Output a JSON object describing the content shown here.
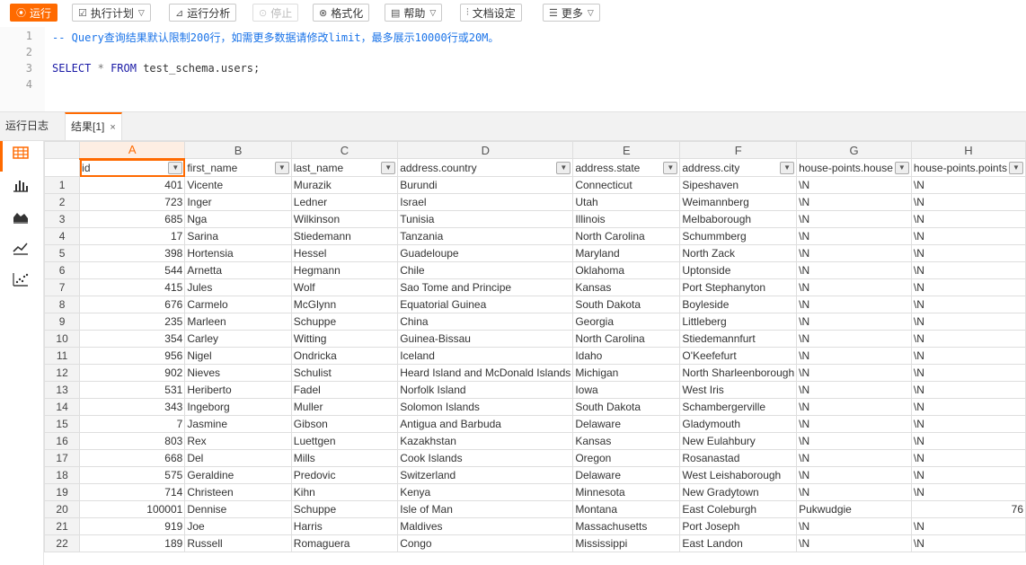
{
  "toolbar": {
    "run": "运行",
    "plan": "执行计划",
    "analyze": "运行分析",
    "stop": "停止",
    "format": "格式化",
    "help": "帮助",
    "doc_settings": "文档设定",
    "more": "更多"
  },
  "editor": {
    "line_numbers": [
      "1",
      "2",
      "3",
      "4"
    ],
    "comment": "-- Query查询结果默认限制200行，如需更多数据请修改limit，最多展示10000行或20M。",
    "sql_select": "SELECT",
    "sql_star": "*",
    "sql_from": "FROM",
    "sql_table": "test_schema.users;"
  },
  "tabs": {
    "log": "运行日志",
    "result": "结果[1]",
    "close": "×"
  },
  "grid": {
    "col_letters": [
      "A",
      "B",
      "C",
      "D",
      "E",
      "F",
      "G",
      "H"
    ],
    "fields": [
      "id",
      "first_name",
      "last_name",
      "address.country",
      "address.state",
      "address.city",
      "house-points.house",
      "house-points.points"
    ],
    "rows": [
      [
        "1",
        "401",
        "Vicente",
        "Murazik",
        "Burundi",
        "Connecticut",
        "Sipeshaven",
        "\\N",
        "\\N"
      ],
      [
        "2",
        "723",
        "Inger",
        "Ledner",
        "Israel",
        "Utah",
        "Weimannberg",
        "\\N",
        "\\N"
      ],
      [
        "3",
        "685",
        "Nga",
        "Wilkinson",
        "Tunisia",
        "Illinois",
        "Melbaborough",
        "\\N",
        "\\N"
      ],
      [
        "4",
        "17",
        "Sarina",
        "Stiedemann",
        "Tanzania",
        "North Carolina",
        "Schummberg",
        "\\N",
        "\\N"
      ],
      [
        "5",
        "398",
        "Hortensia",
        "Hessel",
        "Guadeloupe",
        "Maryland",
        "North Zack",
        "\\N",
        "\\N"
      ],
      [
        "6",
        "544",
        "Arnetta",
        "Hegmann",
        "Chile",
        "Oklahoma",
        "Uptonside",
        "\\N",
        "\\N"
      ],
      [
        "7",
        "415",
        "Jules",
        "Wolf",
        "Sao Tome and Principe",
        "Kansas",
        "Port Stephanyton",
        "\\N",
        "\\N"
      ],
      [
        "8",
        "676",
        "Carmelo",
        "McGlynn",
        "Equatorial Guinea",
        "South Dakota",
        "Boyleside",
        "\\N",
        "\\N"
      ],
      [
        "9",
        "235",
        "Marleen",
        "Schuppe",
        "China",
        "Georgia",
        "Littleberg",
        "\\N",
        "\\N"
      ],
      [
        "10",
        "354",
        "Carley",
        "Witting",
        "Guinea-Bissau",
        "North Carolina",
        "Stiedemannfurt",
        "\\N",
        "\\N"
      ],
      [
        "11",
        "956",
        "Nigel",
        "Ondricka",
        "Iceland",
        "Idaho",
        "O'Keefefurt",
        "\\N",
        "\\N"
      ],
      [
        "12",
        "902",
        "Nieves",
        "Schulist",
        "Heard Island and McDonald Islands",
        "Michigan",
        "North Sharleenborough",
        "\\N",
        "\\N"
      ],
      [
        "13",
        "531",
        "Heriberto",
        "Fadel",
        "Norfolk Island",
        "Iowa",
        "West Iris",
        "\\N",
        "\\N"
      ],
      [
        "14",
        "343",
        "Ingeborg",
        "Muller",
        "Solomon Islands",
        "South Dakota",
        "Schambergerville",
        "\\N",
        "\\N"
      ],
      [
        "15",
        "7",
        "Jasmine",
        "Gibson",
        "Antigua and Barbuda",
        "Delaware",
        "Gladymouth",
        "\\N",
        "\\N"
      ],
      [
        "16",
        "803",
        "Rex",
        "Luettgen",
        "Kazakhstan",
        "Kansas",
        "New Eulahbury",
        "\\N",
        "\\N"
      ],
      [
        "17",
        "668",
        "Del",
        "Mills",
        "Cook Islands",
        "Oregon",
        "Rosanastad",
        "\\N",
        "\\N"
      ],
      [
        "18",
        "575",
        "Geraldine",
        "Predovic",
        "Switzerland",
        "Delaware",
        "West Leishaborough",
        "\\N",
        "\\N"
      ],
      [
        "19",
        "714",
        "Christeen",
        "Kihn",
        "Kenya",
        "Minnesota",
        "New Gradytown",
        "\\N",
        "\\N"
      ],
      [
        "20",
        "100001",
        "Dennise",
        "Schuppe",
        "Isle of Man",
        "Montana",
        "East Coleburgh",
        "Pukwudgie",
        "76"
      ],
      [
        "21",
        "919",
        "Joe",
        "Harris",
        "Maldives",
        "Massachusetts",
        "Port Joseph",
        "\\N",
        "\\N"
      ],
      [
        "22",
        "189",
        "Russell",
        "Romaguera",
        "Congo",
        "Mississippi",
        "East Landon",
        "\\N",
        "\\N"
      ]
    ]
  },
  "colors": {
    "accent": "#ff6a00"
  }
}
